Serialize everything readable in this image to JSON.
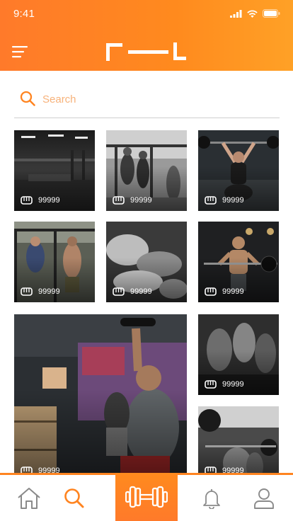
{
  "status_bar": {
    "time": "9:41"
  },
  "header": {
    "menu_icon": "hamburger-menu-icon",
    "logo": "brand-logo"
  },
  "search": {
    "placeholder": "Search",
    "value": ""
  },
  "feed": {
    "tiles": [
      {
        "likes": "99999",
        "scene": "empty gym hall"
      },
      {
        "likes": "99999",
        "scene": "athletes on pull-up rig"
      },
      {
        "likes": "99999",
        "scene": "woman overhead squat"
      },
      {
        "likes": "99999",
        "scene": "men doing pull-ups"
      },
      {
        "likes": "99999",
        "scene": "push-up workout"
      },
      {
        "likes": "99999",
        "scene": "man lifting barbell"
      },
      {
        "likes": "99999",
        "scene": "athlete with dumbbell overhead"
      },
      {
        "likes": "99999",
        "scene": "hands with chalk"
      },
      {
        "likes": "99999",
        "scene": "barbell deadlift"
      }
    ]
  },
  "bottom_nav": {
    "items": [
      "home-icon",
      "search-icon",
      "dumbbell-icon",
      "bell-icon",
      "profile-icon"
    ],
    "active": "dumbbell-icon"
  },
  "colors": {
    "accent": "#ff8420",
    "accent_light": "#ffa126"
  }
}
